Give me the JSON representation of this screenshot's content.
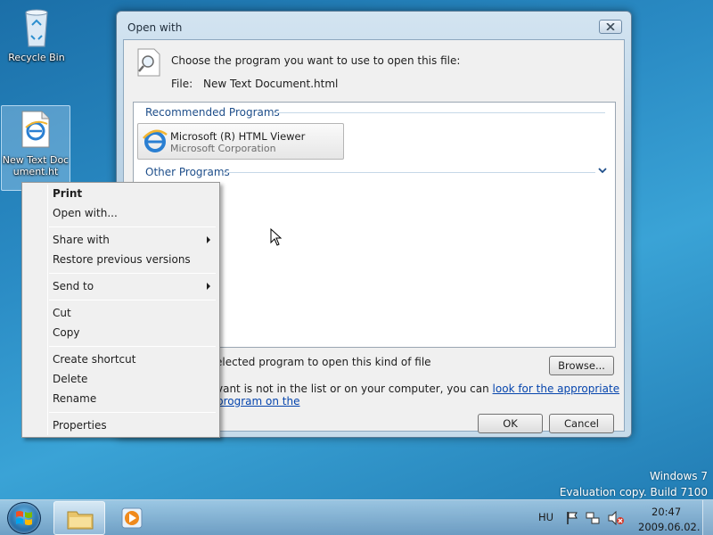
{
  "desktop": {
    "icons": [
      {
        "label": "Recycle Bin"
      },
      {
        "label": "New Text Document.ht"
      }
    ]
  },
  "dialog": {
    "title": "Open with",
    "choose_text": "Choose the program you want to use to open this file:",
    "file_label": "File:",
    "file_name": "New Text Document.html",
    "recommended_header": "Recommended Programs",
    "other_header": "Other Programs",
    "program": {
      "name": "Microsoft (R) HTML Viewer",
      "company": "Microsoft Corporation"
    },
    "always_use_text": "elected program to open this kind of file",
    "not_listed_text": "vant is not in the list or on your computer, you can",
    "lookup_link": "look for the appropriate program on the",
    "browse_label": "Browse...",
    "ok_label": "OK",
    "cancel_label": "Cancel"
  },
  "context_menu": {
    "items": [
      {
        "label": "Print"
      },
      {
        "label": "Open with..."
      },
      {
        "label": "Share with"
      },
      {
        "label": "Restore previous versions"
      },
      {
        "label": "Send to"
      },
      {
        "label": "Cut"
      },
      {
        "label": "Copy"
      },
      {
        "label": "Create shortcut"
      },
      {
        "label": "Delete"
      },
      {
        "label": "Rename"
      },
      {
        "label": "Properties"
      }
    ]
  },
  "watermark": {
    "line1": "Windows 7",
    "line2": "Evaluation copy. Build 7100"
  },
  "taskbar": {
    "language": "HU",
    "time": "20:47",
    "date": "2009.06.02."
  },
  "colors": {
    "accent": "#1e4e8a",
    "link": "#0645ad"
  }
}
